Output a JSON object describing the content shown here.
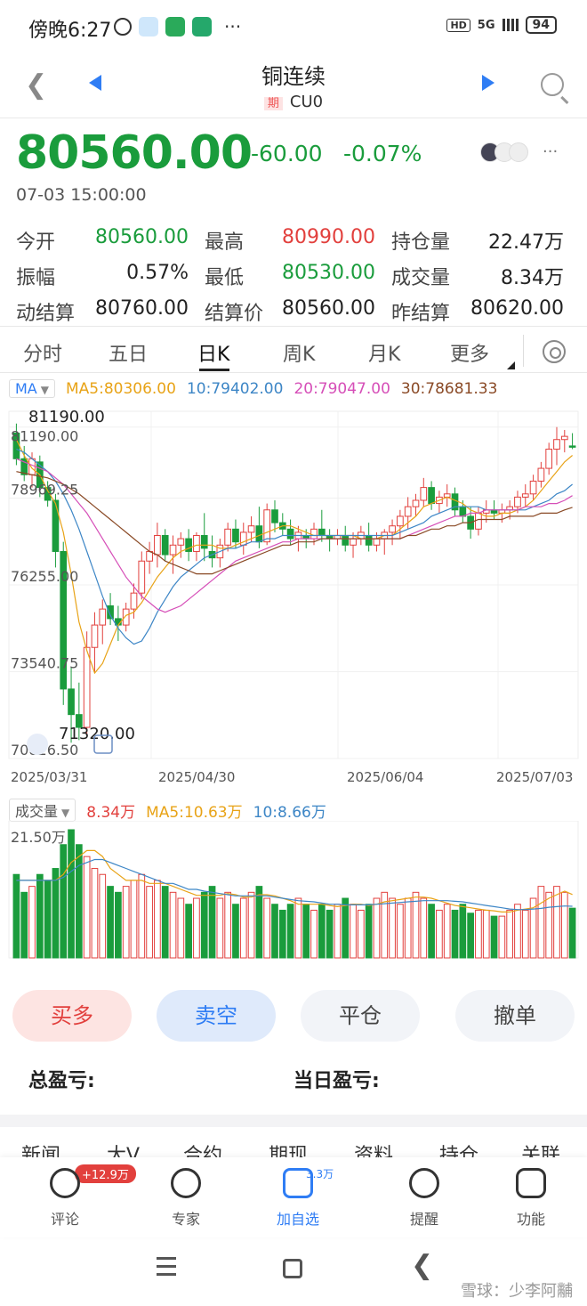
{
  "status_bar": {
    "time": "傍晚6:27",
    "dots": "···",
    "hd": "HD",
    "network": "5G",
    "battery": "94"
  },
  "header": {
    "title": "铜连续",
    "tag": "期",
    "code": "CU0"
  },
  "quote": {
    "price": "80560.00",
    "change": "-60.00",
    "change_pct": "-0.07%",
    "timestamp": "07-03 15:00:00",
    "more": "···"
  },
  "stats": [
    [
      {
        "label": "今开",
        "value": "80560.00",
        "color": "green"
      },
      {
        "label": "最高",
        "value": "80990.00",
        "color": "red"
      },
      {
        "label": "持仓量",
        "value": "22.47万",
        "color": "dark"
      }
    ],
    [
      {
        "label": "振幅",
        "value": "0.57%",
        "color": "dark"
      },
      {
        "label": "最低",
        "value": "80530.00",
        "color": "green"
      },
      {
        "label": "成交量",
        "value": "8.34万",
        "color": "dark"
      }
    ],
    [
      {
        "label": "动结算",
        "value": "80760.00",
        "color": "dark"
      },
      {
        "label": "结算价",
        "value": "80560.00",
        "color": "dark"
      },
      {
        "label": "昨结算",
        "value": "80620.00",
        "color": "dark"
      }
    ]
  ],
  "chart_tabs": [
    "分时",
    "五日",
    "日K",
    "周K",
    "月K",
    "更多"
  ],
  "active_tab": "日K",
  "ma_legend": {
    "selector": "MA",
    "items": [
      {
        "text": "MA5:80306.00",
        "color": "#e8a317"
      },
      {
        "text": "10:79402.00",
        "color": "#3d86c6"
      },
      {
        "text": "20:79047.00",
        "color": "#d64fb8"
      },
      {
        "text": "30:78681.33",
        "color": "#8a4a26"
      }
    ]
  },
  "vol_legend": {
    "selector": "成交量",
    "items": [
      {
        "text": "8.34万",
        "color": "#e2403d"
      },
      {
        "text": "MA5:10.63万",
        "color": "#e8a317"
      },
      {
        "text": "10:8.66万",
        "color": "#3d86c6"
      }
    ]
  },
  "chart_data": {
    "type": "candlestick",
    "y_tick_labels": [
      "81190.00",
      "78969.25",
      "76255.00",
      "73540.75",
      "70826.50"
    ],
    "y_ticks": [
      81190,
      78969.25,
      76255,
      73540.75,
      70826.5
    ],
    "ylim": [
      70826.5,
      81683.5
    ],
    "x_tick_labels": [
      "2025/03/31",
      "2025/04/30",
      "2025/06/04",
      "2025/07/03"
    ],
    "annotations": {
      "high": "81190.00",
      "low": "71320.00"
    },
    "vol_axis_label": "21.50万",
    "vol_max": 21.5,
    "ohlc": [
      [
        81000,
        81300,
        80000,
        80200
      ],
      [
        80200,
        80600,
        79500,
        79700
      ],
      [
        79700,
        80400,
        79300,
        80200
      ],
      [
        80100,
        80300,
        79000,
        79300
      ],
      [
        79300,
        79500,
        78700,
        78900
      ],
      [
        78900,
        79100,
        76800,
        77300
      ],
      [
        77300,
        77600,
        72500,
        73000
      ],
      [
        73000,
        73700,
        71320,
        72200
      ],
      [
        72200,
        73200,
        71400,
        71800
      ],
      [
        71800,
        74800,
        71500,
        74300
      ],
      [
        74300,
        75400,
        73500,
        75000
      ],
      [
        75000,
        75800,
        74400,
        75500
      ],
      [
        75600,
        76000,
        75000,
        75200
      ],
      [
        75200,
        75600,
        74500,
        75000
      ],
      [
        75000,
        75700,
        74800,
        75500
      ],
      [
        75500,
        76300,
        75200,
        76000
      ],
      [
        76000,
        77300,
        75800,
        77000
      ],
      [
        77000,
        77600,
        76600,
        77300
      ],
      [
        77200,
        78200,
        76800,
        77800
      ],
      [
        77800,
        78000,
        77000,
        77200
      ],
      [
        77200,
        77800,
        76600,
        77500
      ],
      [
        77500,
        77900,
        77100,
        77700
      ],
      [
        77700,
        78000,
        77000,
        77300
      ],
      [
        77300,
        77900,
        77000,
        77800
      ],
      [
        77800,
        78500,
        77000,
        77400
      ],
      [
        77300,
        77800,
        76800,
        77100
      ],
      [
        77100,
        77700,
        76800,
        77500
      ],
      [
        77500,
        78200,
        77300,
        78000
      ],
      [
        78000,
        78300,
        77400,
        77600
      ],
      [
        77500,
        78200,
        77200,
        77900
      ],
      [
        77900,
        78400,
        77600,
        78100
      ],
      [
        78100,
        78700,
        77400,
        77600
      ],
      [
        77600,
        78800,
        77500,
        78600
      ],
      [
        78600,
        78900,
        77900,
        78200
      ],
      [
        78200,
        78500,
        77800,
        78000
      ],
      [
        78000,
        78300,
        77500,
        77700
      ],
      [
        77700,
        78100,
        77300,
        77900
      ],
      [
        77800,
        78000,
        77400,
        77700
      ],
      [
        77700,
        78200,
        77500,
        78000
      ],
      [
        78000,
        78600,
        77600,
        77800
      ],
      [
        77800,
        78000,
        77300,
        77700
      ],
      [
        77700,
        78000,
        77500,
        77800
      ],
      [
        77800,
        78100,
        77300,
        77500
      ],
      [
        77500,
        77900,
        77100,
        77700
      ],
      [
        77700,
        78100,
        77500,
        77900
      ],
      [
        77800,
        78200,
        77300,
        77500
      ],
      [
        77500,
        77900,
        77300,
        77700
      ],
      [
        77700,
        78000,
        77200,
        77900
      ],
      [
        77900,
        78300,
        77500,
        78100
      ],
      [
        78100,
        78600,
        77700,
        78400
      ],
      [
        78400,
        79000,
        78000,
        78700
      ],
      [
        78700,
        79100,
        78400,
        78900
      ],
      [
        78900,
        79600,
        78700,
        79300
      ],
      [
        79300,
        79500,
        78600,
        78800
      ],
      [
        78800,
        79200,
        78500,
        79000
      ],
      [
        79000,
        79400,
        78700,
        79100
      ],
      [
        79100,
        79300,
        78400,
        78600
      ],
      [
        78700,
        78900,
        78200,
        78400
      ],
      [
        78400,
        78700,
        77700,
        78000
      ],
      [
        78000,
        78700,
        77800,
        78500
      ],
      [
        78500,
        78900,
        78200,
        78600
      ],
      [
        78600,
        78900,
        78300,
        78500
      ],
      [
        78500,
        78800,
        78200,
        78600
      ],
      [
        78600,
        78900,
        78300,
        78700
      ],
      [
        78700,
        79200,
        78500,
        79000
      ],
      [
        79000,
        79400,
        78700,
        79100
      ],
      [
        79100,
        79700,
        78900,
        79500
      ],
      [
        79500,
        80100,
        79300,
        79900
      ],
      [
        79900,
        80700,
        79700,
        80500
      ],
      [
        80500,
        81190,
        80000,
        80800
      ],
      [
        80800,
        81100,
        80400,
        80900
      ],
      [
        80600,
        81000,
        80500,
        80560
      ]
    ],
    "volume": [
      14,
      11,
      12,
      14,
      13,
      15,
      19,
      21.5,
      19,
      17,
      15,
      14,
      12,
      11,
      12,
      13,
      14,
      12,
      13,
      12,
      11,
      10,
      9,
      10,
      11,
      12,
      10,
      11,
      9,
      10,
      11,
      12,
      10,
      9,
      8,
      9,
      10,
      9,
      8,
      9,
      8,
      9,
      10,
      9,
      8,
      9,
      10,
      11,
      10,
      9,
      10,
      11,
      10,
      9,
      8,
      9,
      8,
      9,
      7.5,
      8,
      8,
      7,
      7,
      8,
      9,
      8,
      10,
      12,
      11,
      12,
      11,
      8.34
    ],
    "ma_series": {
      "ma5": [
        80800,
        80300,
        79900,
        79700,
        79200,
        78800,
        77900,
        76600,
        75100,
        74200,
        73500,
        73800,
        74400,
        75000,
        75300,
        75400,
        75700,
        76100,
        76500,
        76800,
        77100,
        77300,
        77400,
        77500,
        77500,
        77500,
        77400,
        77400,
        77500,
        77600,
        77700,
        77800,
        77900,
        78000,
        78100,
        78100,
        78000,
        77900,
        77800,
        77800,
        77800,
        77800,
        77800,
        77800,
        77700,
        77700,
        77700,
        77800,
        77800,
        78000,
        78200,
        78400,
        78700,
        78800,
        78900,
        79000,
        78900,
        78800,
        78600,
        78500,
        78400,
        78400,
        78500,
        78500,
        78600,
        78700,
        78900,
        79200,
        79500,
        79800,
        80100,
        80306
      ],
      "ma10": [
        80500,
        80400,
        80200,
        80000,
        79800,
        79500,
        79100,
        78600,
        78000,
        77300,
        76600,
        75900,
        75300,
        74900,
        74600,
        74400,
        74500,
        74900,
        75400,
        75800,
        76200,
        76500,
        76700,
        76900,
        77100,
        77200,
        77300,
        77400,
        77400,
        77500,
        77600,
        77600,
        77700,
        77700,
        77800,
        77800,
        77800,
        77800,
        77800,
        77800,
        77800,
        77800,
        77800,
        77800,
        77800,
        77800,
        77800,
        77800,
        77800,
        77900,
        78000,
        78100,
        78200,
        78400,
        78500,
        78600,
        78700,
        78700,
        78700,
        78700,
        78600,
        78600,
        78600,
        78600,
        78600,
        78600,
        78700,
        78800,
        78900,
        79100,
        79200,
        79402
      ],
      "ma20": [
        80200,
        80100,
        80000,
        79900,
        79800,
        79600,
        79400,
        79100,
        78800,
        78500,
        78100,
        77700,
        77300,
        76900,
        76500,
        76200,
        75900,
        75700,
        75500,
        75400,
        75500,
        75600,
        75800,
        76000,
        76200,
        76400,
        76600,
        76800,
        77000,
        77100,
        77200,
        77300,
        77400,
        77500,
        77600,
        77600,
        77700,
        77700,
        77700,
        77700,
        77700,
        77700,
        77700,
        77700,
        77700,
        77700,
        77700,
        77700,
        77700,
        77700,
        77800,
        77900,
        78000,
        78100,
        78200,
        78300,
        78400,
        78400,
        78500,
        78500,
        78600,
        78600,
        78600,
        78600,
        78600,
        78700,
        78700,
        78700,
        78800,
        78800,
        78900,
        79047
      ],
      "ma30": [
        79800,
        79750,
        79700,
        79650,
        79600,
        79500,
        79400,
        79250,
        79100,
        78900,
        78700,
        78500,
        78300,
        78100,
        77900,
        77700,
        77500,
        77300,
        77200,
        77000,
        76900,
        76800,
        76700,
        76600,
        76600,
        76600,
        76700,
        76800,
        76900,
        77000,
        77100,
        77200,
        77300,
        77400,
        77500,
        77500,
        77600,
        77600,
        77600,
        77700,
        77700,
        77700,
        77700,
        77700,
        77700,
        77700,
        77700,
        77700,
        77700,
        77700,
        77800,
        77800,
        77900,
        78000,
        78000,
        78100,
        78100,
        78200,
        78200,
        78300,
        78300,
        78300,
        78300,
        78400,
        78400,
        78400,
        78400,
        78500,
        78500,
        78500,
        78600,
        78681
      ]
    },
    "vol_ma": {
      "ma5": [
        13,
        13,
        13,
        13,
        13,
        13,
        14,
        16,
        17,
        18,
        18,
        17,
        15,
        14,
        13,
        13,
        13,
        12.5,
        12.5,
        12.5,
        12,
        11.5,
        11,
        10.5,
        10.5,
        10.5,
        10.5,
        10.8,
        10.6,
        10.2,
        10.2,
        10.6,
        10.6,
        10.4,
        10,
        9.6,
        9,
        9,
        9,
        9,
        8.8,
        8.6,
        8.8,
        9,
        9,
        8.8,
        9,
        9.4,
        9.6,
        9.8,
        10,
        10.2,
        10.2,
        10,
        9.6,
        9.2,
        8.8,
        8.6,
        8.4,
        8.2,
        8,
        7.9,
        7.7,
        7.7,
        8,
        8.2,
        8.4,
        9.2,
        10,
        10.6,
        11.2,
        10.63
      ],
      "ma10": [
        13,
        13,
        13,
        13,
        13,
        13,
        13.5,
        14.5,
        15.5,
        16,
        16.5,
        16.5,
        16,
        15.5,
        15,
        14.5,
        14,
        13.5,
        13,
        12.5,
        12.5,
        12,
        11.5,
        11.5,
        11.2,
        11,
        10.8,
        10.6,
        10.4,
        10.4,
        10.4,
        10.4,
        10.4,
        10.2,
        10,
        9.8,
        9.6,
        9.5,
        9.4,
        9.2,
        9,
        9,
        8.9,
        8.9,
        8.9,
        8.9,
        9,
        9.1,
        9.2,
        9.3,
        9.4,
        9.5,
        9.6,
        9.6,
        9.6,
        9.6,
        9.5,
        9.4,
        9.2,
        9,
        8.8,
        8.6,
        8.4,
        8.2,
        8.1,
        8.1,
        8.2,
        8.3,
        8.5,
        8.6,
        8.7,
        8.66
      ]
    }
  },
  "actions": {
    "buy": "买多",
    "sell": "卖空",
    "close": "平仓",
    "cancel": "撤单"
  },
  "pnl": {
    "total_label": "总盈亏:",
    "day_label": "当日盈亏:"
  },
  "news_tabs": [
    "新闻",
    "大V",
    "合约",
    "期现",
    "资料",
    "持仓",
    "关联"
  ],
  "bottom_bar": {
    "items": [
      {
        "label": "评论",
        "icon": "comment-icon"
      },
      {
        "label": "专家",
        "icon": "expert-icon"
      },
      {
        "label": "加自选",
        "icon": "add-watchlist-icon"
      },
      {
        "label": "提醒",
        "icon": "alarm-icon"
      },
      {
        "label": "功能",
        "icon": "function-icon"
      }
    ],
    "comment_badge": "+12.9万",
    "watch_count": "3.3万"
  },
  "watermark": "雪球：少李阿黼",
  "colors": {
    "up": "#e2403d",
    "down": "#1a9c3c",
    "accent": "#2f7df4"
  }
}
